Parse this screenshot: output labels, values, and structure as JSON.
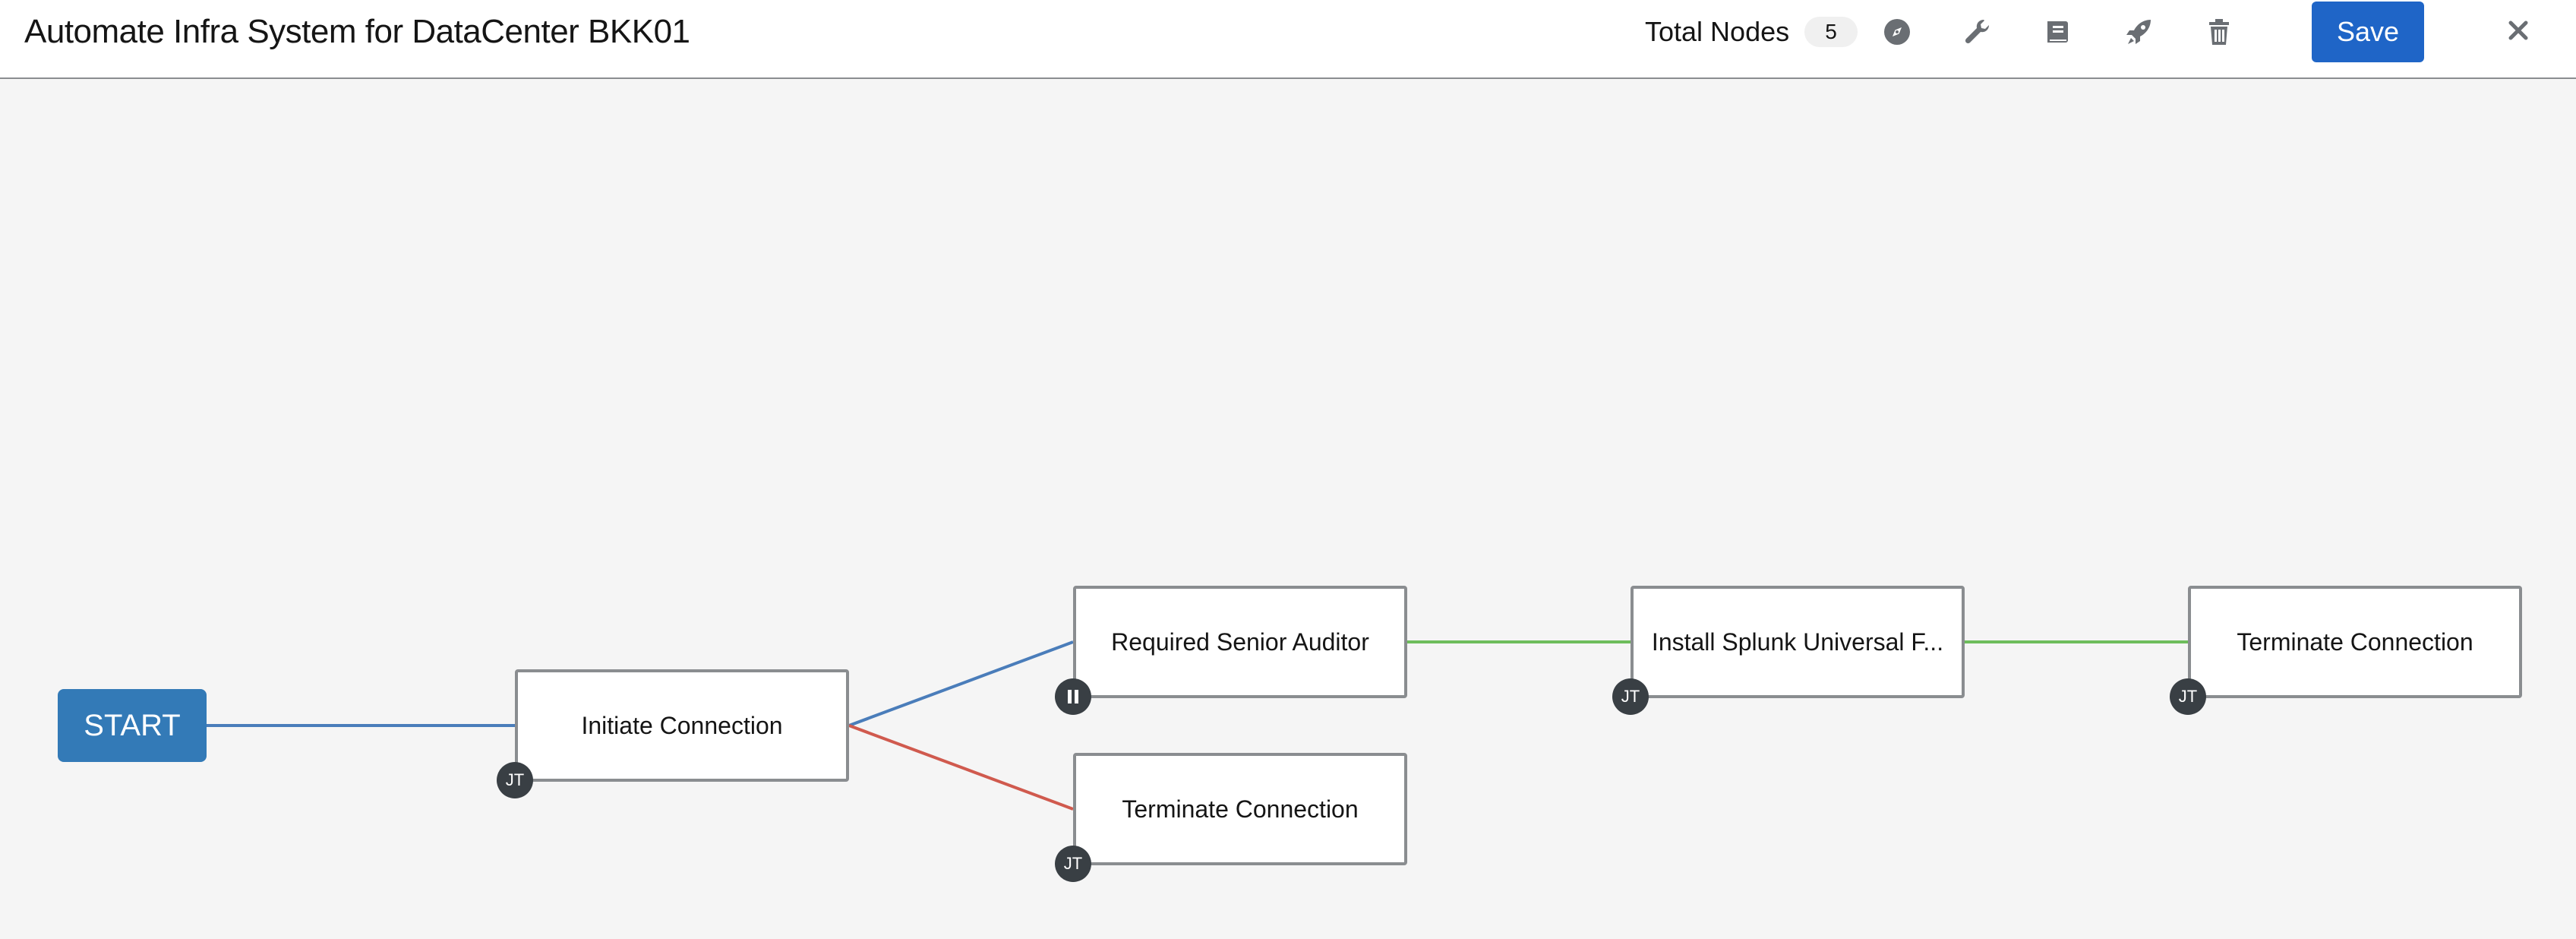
{
  "header": {
    "title": "Automate Infra System for DataCenter BKK01",
    "total_nodes_label": "Total Nodes",
    "total_nodes_count": "5",
    "icons": [
      "compass-icon",
      "wrench-icon",
      "book-icon",
      "rocket-icon",
      "trash-icon"
    ],
    "save_label": "Save",
    "close_icon": "close-icon"
  },
  "colors": {
    "primary": "#0066cc",
    "start_node": "#337ab7",
    "link_always": "#4a7dba",
    "link_success": "#6ebd5c",
    "link_failure": "#d05a4e",
    "badge": "#393f44",
    "canvas": "#f5f5f5"
  },
  "workflow": {
    "start_label": "START",
    "nodes": [
      {
        "label": "Initiate Connection",
        "badge": "JT",
        "badge_type": "job-template"
      },
      {
        "label": "Required Senior Auditor",
        "badge": "",
        "badge_type": "approval-pause"
      },
      {
        "label": "Terminate Connection",
        "badge": "JT",
        "badge_type": "job-template"
      },
      {
        "label": "Install Splunk Universal F...",
        "badge": "JT",
        "badge_type": "job-template"
      },
      {
        "label": "Terminate Connection",
        "badge": "JT",
        "badge_type": "job-template"
      }
    ],
    "links": [
      {
        "from": "START",
        "to": "Initiate Connection",
        "type": "always"
      },
      {
        "from": "Initiate Connection",
        "to": "Required Senior Auditor",
        "type": "always"
      },
      {
        "from": "Initiate Connection",
        "to": "Terminate Connection",
        "type": "failure"
      },
      {
        "from": "Required Senior Auditor",
        "to": "Install Splunk Universal F...",
        "type": "success"
      },
      {
        "from": "Install Splunk Universal F...",
        "to": "Terminate Connection",
        "type": "success"
      }
    ]
  }
}
